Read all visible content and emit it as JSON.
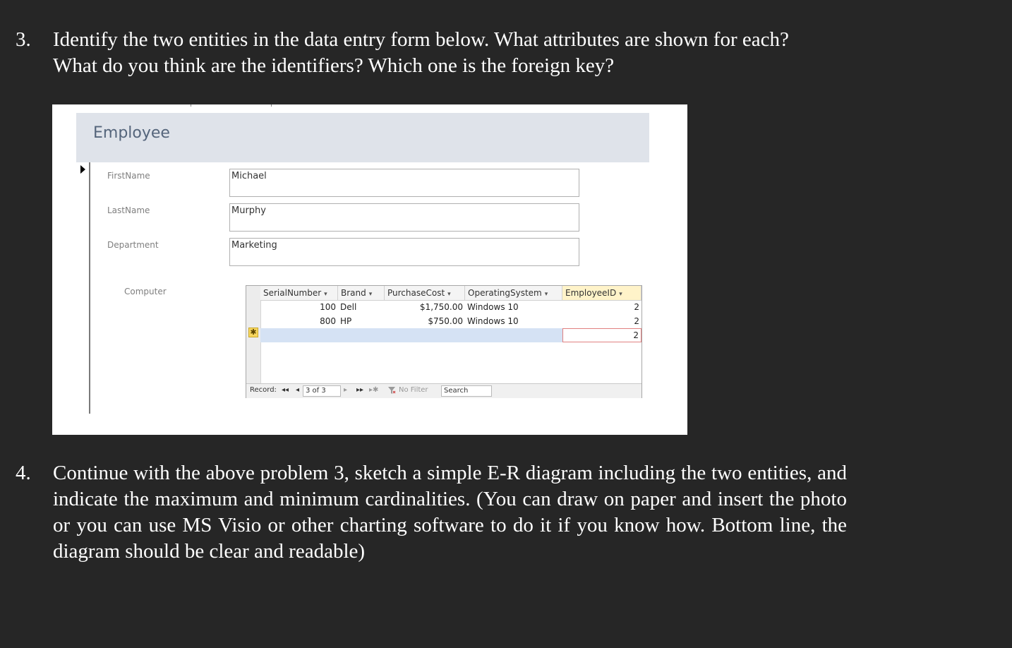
{
  "questions": [
    {
      "number": "3.",
      "lines": [
        "Identify the two entities in the data entry form below. What attributes are shown for each?",
        "What do you think are the identifiers? Which one is the foreign key?"
      ]
    },
    {
      "number": "4.",
      "text": "Continue with the above problem 3, sketch a simple E-R diagram including the two entities, and indicate the maximum and minimum cardinalities. (You can draw on paper and insert the photo or you can use MS Visio or other charting software to do it if you know how. Bottom line, the diagram should be clear and readable)"
    }
  ],
  "form": {
    "title": "Employee",
    "fields": [
      {
        "label": "FirstName",
        "value": "Michael"
      },
      {
        "label": "LastName",
        "value": "Murphy"
      },
      {
        "label": "Department",
        "value": "Marketing"
      }
    ],
    "subform_label": "Computer",
    "subform": {
      "columns": [
        "SerialNumber",
        "Brand",
        "PurchaseCost",
        "OperatingSystem",
        "EmployeeID"
      ],
      "dropdown_glyph": "▾",
      "rows": [
        [
          "100",
          "Dell",
          "$1,750.00",
          "Windows 10",
          "2"
        ],
        [
          "800",
          "HP",
          "$750.00",
          "Windows 10",
          "2"
        ]
      ],
      "new_row_employee_id": "2",
      "new_row_marker": "✱"
    },
    "navigation": {
      "record_label": "Record:",
      "first_glyph": "◂◂",
      "prev_glyph": "◂",
      "position": "3 of 3",
      "next_glyph": "▸",
      "last_glyph": "▸▸",
      "new_glyph": "▸✱",
      "filter_icon": "funnel-icon",
      "filter_label": "No Filter",
      "search_label": "Search"
    }
  }
}
